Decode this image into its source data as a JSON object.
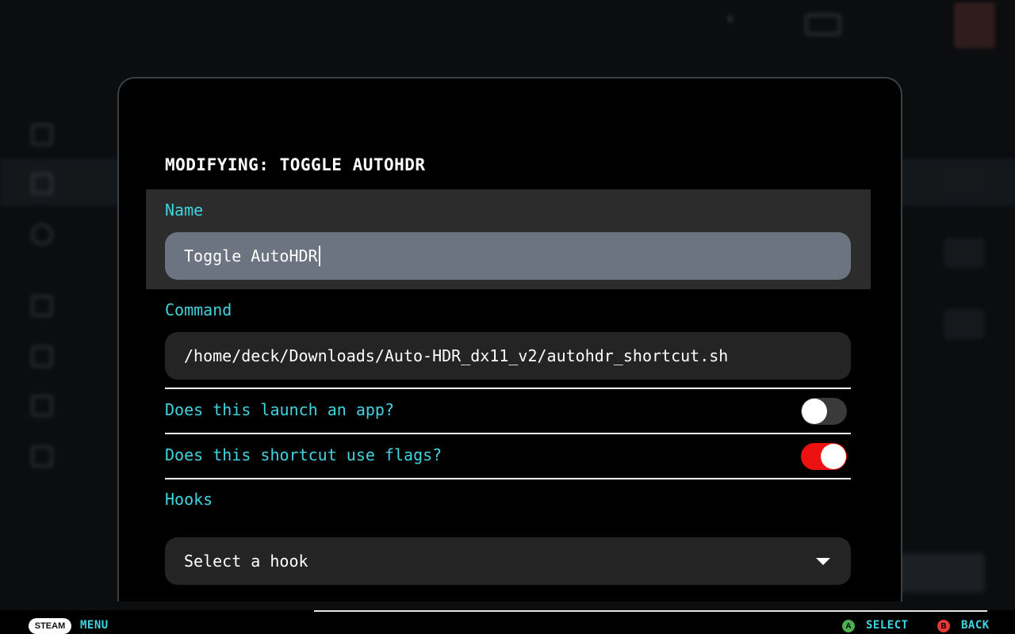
{
  "colors": {
    "accent": "#40d4e0",
    "toggle_on": "#ee1111",
    "toggle_off": "#3a3a3a",
    "modal_bg": "#000000",
    "input_bg": "#242424",
    "input_active_bg": "#6b7480",
    "button_a": "#4caf50",
    "button_b": "#e53935"
  },
  "modal": {
    "title": "MODIFYING: TOGGLE AUTOHDR",
    "name_field": {
      "label": "Name",
      "value": "Toggle AutoHDR"
    },
    "command_field": {
      "label": "Command",
      "value": "/home/deck/Downloads/Auto-HDR_dx11_v2/autohdr_shortcut.sh"
    },
    "toggles": [
      {
        "label": "Does this launch an app?",
        "on": false
      },
      {
        "label": "Does this shortcut use flags?",
        "on": true
      }
    ],
    "hooks": {
      "label": "Hooks",
      "selected": "Select a hook",
      "icon": "chevron-down-icon"
    }
  },
  "footer": {
    "steam_label": "STEAM",
    "menu_label": "MENU",
    "select_glyph": "A",
    "select_label": "SELECT",
    "back_glyph": "B",
    "back_label": "BACK"
  }
}
